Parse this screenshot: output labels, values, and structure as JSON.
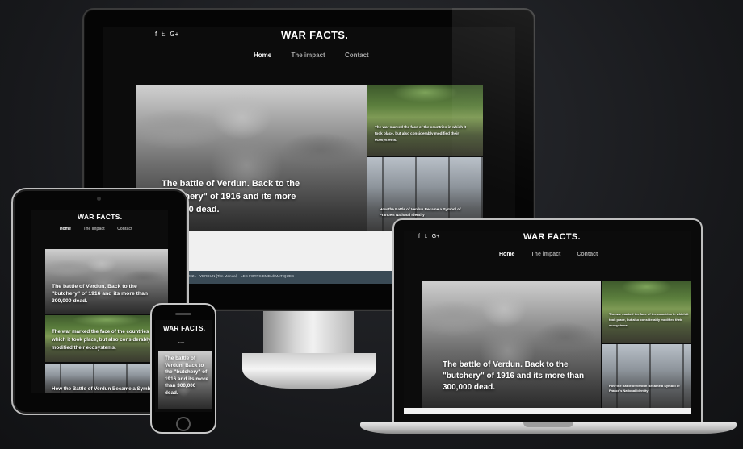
{
  "site": {
    "logo": "WAR FACTS.",
    "social": "f ♥ G+",
    "nav": [
      "Home",
      "The impact",
      "Contact"
    ],
    "hero_text": "The battle of Verdun. Back to the \"butchery\" of 1916 and its more than 300,000 dead.",
    "hero_text_desktop": "The battle of Verdun. Back to the \"butchery\" of 1916 and its more 300,000 dead.",
    "card1_text": "The war marked the face of the countries in which it took place, but also considerably modified their ecosystems.",
    "card2_text": "How the Battle of Verdun Became a Symbol of France's National Identity",
    "footer_text": "© 2021 - VERDUN [Tim Manual] - LES FORTS EMBLÈMATIQUES",
    "phone_nav_active": "Home",
    "phone_hero_text": "The battle of Verdun. Back to the \"butchery\" of 1916 and its more than 300,000 dead."
  },
  "colors": {
    "background": "#17181b",
    "site_bg": "#0c0c0c",
    "nav_inactive": "#a7a7a7",
    "text": "#ffffff"
  },
  "icons": {
    "social": [
      "facebook-icon",
      "twitter-icon",
      "google-plus-icon"
    ]
  }
}
